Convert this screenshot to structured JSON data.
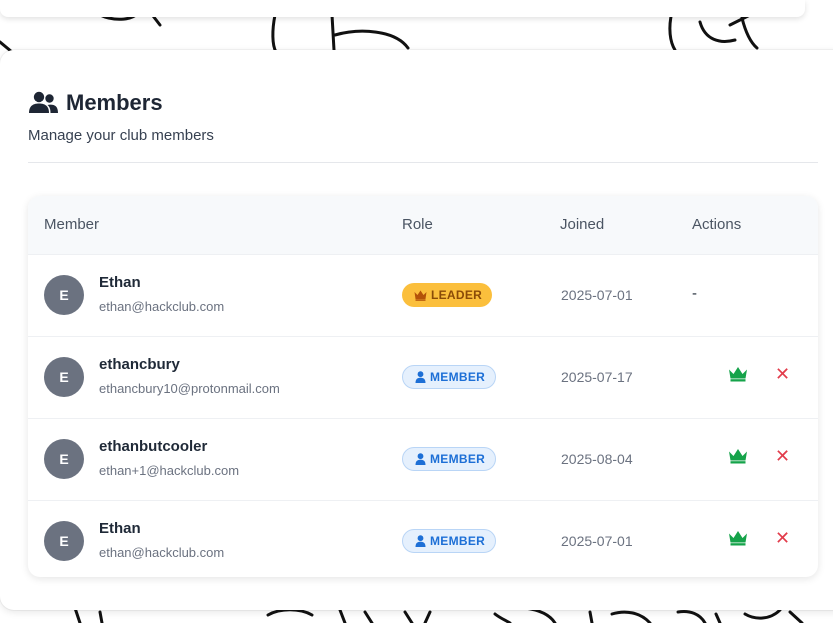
{
  "header": {
    "title": "Members",
    "subtitle": "Manage your club members",
    "icon": "users-icon"
  },
  "table": {
    "columns": [
      "Member",
      "Role",
      "Joined",
      "Actions"
    ],
    "rows": [
      {
        "initial": "E",
        "name": "Ethan",
        "email": "ethan@hackclub.com",
        "role": "LEADER",
        "joined": "2025-07-01",
        "actions_text": "-"
      },
      {
        "initial": "E",
        "name": "ethancbury",
        "email": "ethancbury10@protonmail.com",
        "role": "MEMBER",
        "joined": "2025-07-17",
        "actions_text": ""
      },
      {
        "initial": "E",
        "name": "ethanbutcooler",
        "email": "ethan+1@hackclub.com",
        "role": "MEMBER",
        "joined": "2025-08-04",
        "actions_text": ""
      },
      {
        "initial": "E",
        "name": "Ethan",
        "email": "ethan@hackclub.com",
        "role": "MEMBER",
        "joined": "2025-07-01",
        "actions_text": ""
      }
    ]
  },
  "actions": {
    "promote_icon": "crown-icon",
    "remove_icon": "close-icon",
    "remove_glyph": "✕"
  },
  "colors": {
    "leader_badge": "#fbbf3c",
    "member_badge": "#e5f0fd",
    "member_text": "#1d6fd6",
    "promote": "#15a34a",
    "remove": "#e23c4b",
    "avatar": "#6b7280"
  }
}
